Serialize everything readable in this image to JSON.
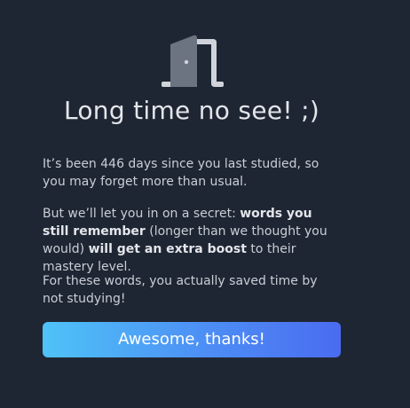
{
  "dialog": {
    "icon": "door-icon",
    "title": "Long time no see! ;)",
    "paragraph1": "It’s been 446 days since you last studied, so you may forget more than usual.",
    "paragraph2": {
      "part1": "But we’ll let you in on a secret: ",
      "bold1": "words you still remember",
      "part2": " (longer than we thought you would) ",
      "bold2": "will get an extra boost",
      "part3": " to their mastery level."
    },
    "paragraph3": "For these words, you actually saved time by not studying!",
    "button_label": "Awesome, thanks!"
  },
  "colors": {
    "background": "#1f2633",
    "text": "#c9ced6",
    "title": "#e3e6ea",
    "button_gradient_start": "#4fc3f7",
    "button_gradient_end": "#4a6cf0",
    "icon_door": "#6b7480",
    "icon_frame": "#d0d4da"
  }
}
